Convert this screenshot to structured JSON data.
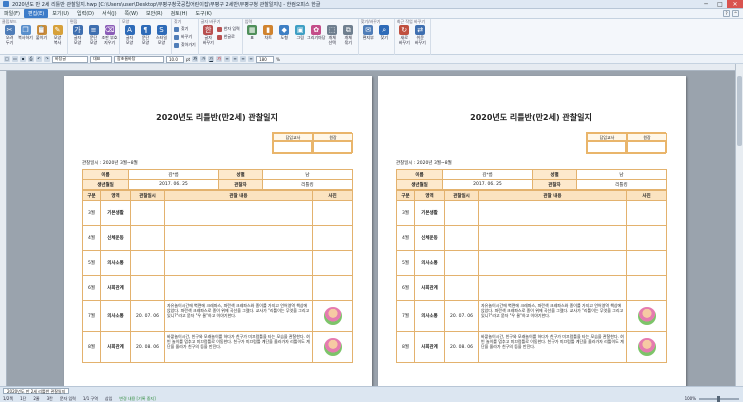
{
  "window": {
    "title": "2020년도 만 2세 리틀반 관찰일지.hwp [C:\\Users\\user\\Desktop\\부평구청국공립어린이집\\부평구 2세반\\부평구청 관찰일지\\] - 한컴오피스 한글",
    "minimize": "─",
    "maximize": "□",
    "close": "✕"
  },
  "menu": {
    "items": [
      "파일(F)",
      "편집(E)",
      "보기(U)",
      "입력(D)",
      "서식(J)",
      "쪽(W)",
      "보안(R)",
      "검토(H)",
      "도구(K)"
    ],
    "active_index": 1
  },
  "ribbon": {
    "groups": [
      {
        "label": "클립보드",
        "buttons": [
          {
            "label": "오려\n두기",
            "icon": "scissors-icon",
            "glyph": "✂",
            "color": "#4f7db8"
          },
          {
            "label": "복사하기",
            "icon": "copy-icon",
            "glyph": "❐",
            "color": "#5a8fcc"
          },
          {
            "label": "붙이기",
            "icon": "paste-icon",
            "glyph": "📋",
            "color": "#c98f3a"
          },
          {
            "label": "모양\n복사",
            "icon": "format-painter-icon",
            "glyph": "✎",
            "color": "#d7a13a"
          }
        ]
      },
      {
        "label": "편집",
        "buttons": [
          {
            "label": "글자\n모양",
            "icon": "char-shape-icon",
            "glyph": "가",
            "color": "#3f6fb0"
          },
          {
            "label": "문단\n모양",
            "icon": "para-shape-icon",
            "glyph": "≡",
            "color": "#3f6fb0"
          },
          {
            "label": "조판 부호\n지우기",
            "icon": "clear-format-icon",
            "glyph": "⌫",
            "color": "#8b5db8"
          }
        ]
      },
      {
        "label": "모양",
        "buttons": [
          {
            "label": "글자\n모양",
            "icon": "font-icon",
            "glyph": "A",
            "color": "#2e6bb8"
          },
          {
            "label": "문단\n모양",
            "icon": "paragraph-icon",
            "glyph": "¶",
            "color": "#2e6bb8"
          },
          {
            "label": "스타일\n모양",
            "icon": "style-icon",
            "glyph": "S",
            "color": "#2e6bb8"
          }
        ]
      },
      {
        "label": "찾기",
        "list": [
          {
            "label": "찾기",
            "icon": "find-icon",
            "color": "#4f7db8"
          },
          {
            "label": "바꾸기",
            "icon": "replace-icon",
            "color": "#4f7db8"
          },
          {
            "label": "찾아가기",
            "icon": "goto-icon",
            "color": "#4f7db8"
          }
        ]
      },
      {
        "label": "글자 바꾸기",
        "buttons": [
          {
            "label": "글자\n바꾸기",
            "icon": "convert-char-icon",
            "glyph": "한",
            "color": "#b85050"
          }
        ],
        "list": [
          {
            "label": "한자 입력",
            "icon": "hanja-icon",
            "color": "#b85050"
          },
          {
            "label": "한글로",
            "icon": "hangul-icon",
            "color": "#b85050"
          }
        ]
      },
      {
        "label": "입력",
        "buttons": [
          {
            "label": "표",
            "icon": "table-icon",
            "glyph": "▦",
            "color": "#4f8f5a"
          },
          {
            "label": "차트",
            "icon": "chart-icon",
            "glyph": "▮",
            "color": "#d0832e"
          },
          {
            "label": "도형",
            "icon": "shape-icon",
            "glyph": "◆",
            "color": "#3e7fc4"
          },
          {
            "label": "그림",
            "icon": "picture-icon",
            "glyph": "▣",
            "color": "#3e9fc4"
          },
          {
            "label": "그리기마당",
            "icon": "clipart-icon",
            "glyph": "✿",
            "color": "#c44e8a"
          },
          {
            "label": "개체\n선택",
            "icon": "select-object-icon",
            "glyph": "⬚",
            "color": "#6f7f8f"
          },
          {
            "label": "개체\n묶기",
            "icon": "group-object-icon",
            "glyph": "⧉",
            "color": "#6f7f8f"
          }
        ]
      },
      {
        "label": "찾기/바꾸기",
        "buttons": [
          {
            "label": "편지부",
            "icon": "mail-merge-icon",
            "glyph": "✉",
            "color": "#4f7db8"
          },
          {
            "label": "찾기",
            "icon": "search-icon",
            "glyph": "⌕",
            "color": "#2e6bb8"
          }
        ]
      },
      {
        "label": "최근 작업 바꾸기",
        "buttons": [
          {
            "label": "새로\n바꾸기",
            "icon": "new-replace-icon",
            "glyph": "↻",
            "color": "#c05040"
          },
          {
            "label": "쉬운\n바꾸기",
            "icon": "easy-replace-icon",
            "glyph": "⇄",
            "color": "#3f6fb0"
          }
        ]
      }
    ]
  },
  "formatbar": {
    "style_value": "바탕글",
    "font_lang": "대표",
    "font_value": "함초롬바탕",
    "size_value": "10.0",
    "size_unit": "pt",
    "zoom_value": "180",
    "zoom_unit": "%"
  },
  "document": {
    "title": "2020년도 리틀반(만2세) 관찰일지",
    "period": "관찰일시 : 2020년 3월~8월",
    "approval": {
      "h1": "담임교사",
      "h2": "원장"
    },
    "info": {
      "name_label": "이름",
      "name_value": "김*름",
      "gender_label": "성별",
      "gender_value": "남",
      "birth_label": "생년월일",
      "birth_value": "2017. 06. 25",
      "observer_label": "관찰자",
      "observer_value": "리틀킹"
    },
    "table_headers": [
      "구분",
      "영역",
      "관찰일시",
      "관찰 내용",
      "사진"
    ],
    "rows": [
      {
        "month": "3월",
        "area": "기본생활",
        "date": "",
        "note": "",
        "photo": false
      },
      {
        "month": "4월",
        "area": "신체운동",
        "date": "",
        "note": "",
        "photo": false
      },
      {
        "month": "5월",
        "area": "의사소통",
        "date": "",
        "note": "",
        "photo": false
      },
      {
        "month": "6월",
        "area": "사회관계",
        "date": "",
        "note": "",
        "photo": false
      },
      {
        "month": "7월",
        "area": "의사소통",
        "date": "20. 07. 06",
        "note": "자유놀이시간에 벽면에 크레파스, 파란색 크레파스와 종이를 가지고 언어영역 책상에 앉았다. 파란색 크레파스로 종이 위에 곡선을 그렸다. 교사가 \"리틀이는 무엇을 그리고 있니?\"라고 묻자 \"우 물\"하고 이야기한다.",
        "photo": true
      },
      {
        "month": "8월",
        "area": "사회관계",
        "date": "20. 08. 06",
        "note": "바깥놀이시간, 친구와 모래놀이를 하다가 친구가 미끄럼틀을 타는 모습을 관찰한다. 혀빈 놀이를 멈추고 미끄럼틀로 이동한다. 친구가 미끄럼틀 계단을 올라가자 리틀이도 계단을 올라가 친구의 등을 만진다.",
        "photo": true
      }
    ]
  },
  "statusbar": {
    "doc_tab": "2020년도 만 2세 리틀반 관찰일지",
    "page": "1/2쪽",
    "section": "1단",
    "line": "2줄",
    "col": "3칸",
    "chars": "문자 입력",
    "sections": "1/1 구역",
    "insert_mode": "삽입",
    "change": "변경 내용 [기록 중지]",
    "zoom": "100%"
  }
}
